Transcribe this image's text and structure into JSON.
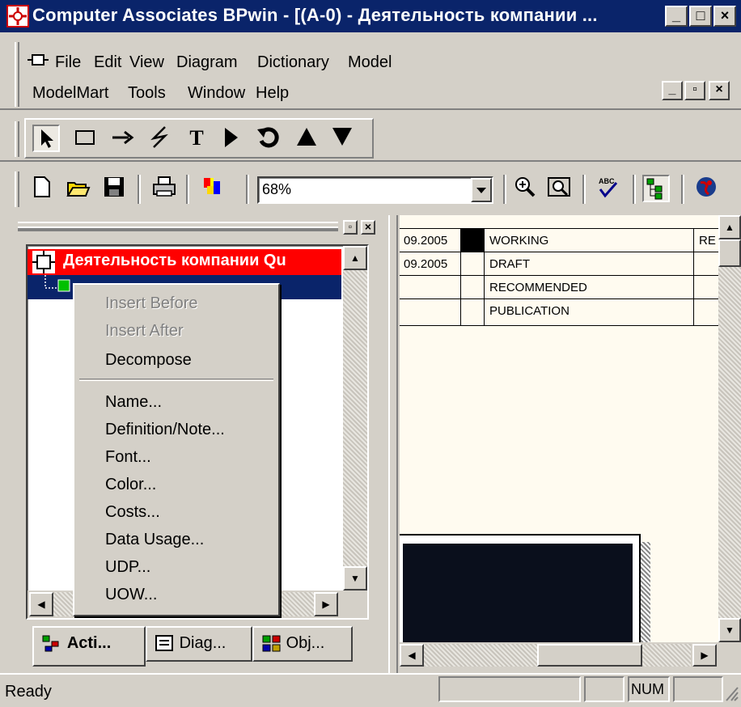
{
  "window": {
    "title": "Computer Associates BPwin - [(A-0) - Деятельность компании ..."
  },
  "menu": {
    "row1": [
      "File",
      "Edit",
      "View",
      "Diagram",
      "Dictionary",
      "Model"
    ],
    "row2": [
      "ModelMart",
      "Tools",
      "Window",
      "Help"
    ]
  },
  "toolbar": {
    "zoom_value": "68%"
  },
  "tree": {
    "root_label": "Деятельность компании Qu"
  },
  "context_menu": {
    "items": [
      "Insert Before",
      "Insert After",
      "Decompose",
      "Name...",
      "Definition/Note...",
      "Font...",
      "Color...",
      "Costs...",
      "Data Usage...",
      "UDP...",
      "UOW..."
    ]
  },
  "tabs": [
    "Acti...",
    "Diag...",
    "Obj..."
  ],
  "diagram": {
    "dates": [
      "09.2005",
      "09.2005"
    ],
    "statuses": [
      "WORKING",
      "DRAFT",
      "RECOMMENDED",
      "PUBLICATION"
    ],
    "header_right": "RE"
  },
  "statusbar": {
    "text": "Ready",
    "num": "NUM"
  },
  "colors": {
    "titlebar": "#0a246a",
    "tree_root_bg": "#ff0000",
    "selection": "#0a246a"
  }
}
